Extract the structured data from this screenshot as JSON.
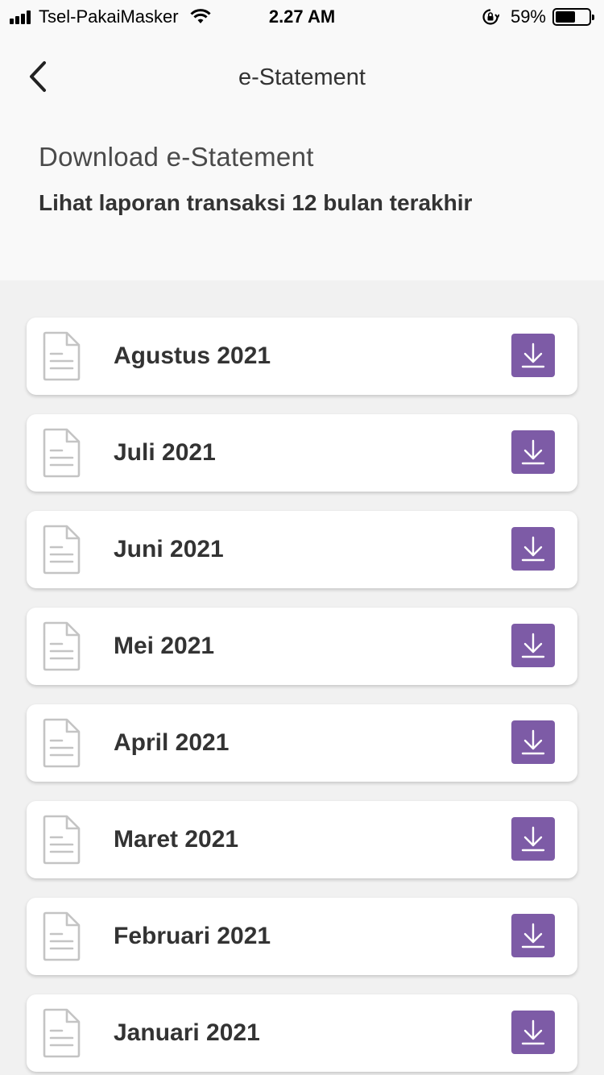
{
  "status_bar": {
    "carrier": "Tsel-PakaiMasker",
    "time": "2.27 AM",
    "battery_percent": "59%",
    "battery_level": 0.59,
    "icons": [
      "signal-icon",
      "wifi-icon",
      "rotation-lock-icon",
      "battery-icon"
    ]
  },
  "nav": {
    "title": "e-Statement",
    "back_icon": "chevron-left-icon"
  },
  "header": {
    "title": "Download e-Statement",
    "subtitle": "Lihat laporan transaksi 12 bulan terakhir"
  },
  "colors": {
    "accent": "#7d5ba6",
    "background": "#f1f1f1",
    "header_background": "#f9f9f9"
  },
  "statements": [
    {
      "label": "Agustus 2021",
      "icon": "document-icon",
      "action_icon": "download-icon"
    },
    {
      "label": "Juli 2021",
      "icon": "document-icon",
      "action_icon": "download-icon"
    },
    {
      "label": "Juni 2021",
      "icon": "document-icon",
      "action_icon": "download-icon"
    },
    {
      "label": "Mei 2021",
      "icon": "document-icon",
      "action_icon": "download-icon"
    },
    {
      "label": "April 2021",
      "icon": "document-icon",
      "action_icon": "download-icon"
    },
    {
      "label": "Maret 2021",
      "icon": "document-icon",
      "action_icon": "download-icon"
    },
    {
      "label": "Februari 2021",
      "icon": "document-icon",
      "action_icon": "download-icon"
    },
    {
      "label": "Januari 2021",
      "icon": "document-icon",
      "action_icon": "download-icon"
    }
  ]
}
